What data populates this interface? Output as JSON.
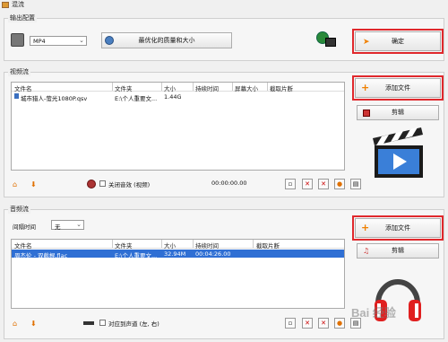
{
  "window": {
    "title": "混流"
  },
  "output": {
    "group_label": "输出配置",
    "format_value": "MP4",
    "quality_button": "最优化的质量和大小",
    "confirm_button": "确定"
  },
  "video": {
    "group_label": "视频流",
    "add_file_button": "添加文件",
    "edit_button": "剪辑",
    "columns": [
      "文件名",
      "文件夹",
      "大小",
      "持续时间",
      "屏幕大小",
      "截取片断"
    ],
    "rows": [
      {
        "name": "城市猎人-萤光1080P.qsv",
        "folder": "E:\\个人重要文...",
        "size": "1.44G",
        "duration": "",
        "screen": "",
        "clip": ""
      }
    ],
    "mute_label": "关闭音效 (视频)",
    "time": "00:00:00.00"
  },
  "audio": {
    "group_label": "音频流",
    "interval_label": "间隔时间",
    "interval_value": "无",
    "add_file_button": "添加文件",
    "edit_button": "剪辑",
    "columns": [
      "文件名",
      "文件夹",
      "大小",
      "持续时间",
      "截取片断"
    ],
    "rows": [
      {
        "name": "周杰伦 - 双截棍.flac",
        "folder": "E:\\个人重要文...",
        "size": "32.94M",
        "duration": "00:04:26.00",
        "clip": ""
      }
    ],
    "align_label": "对应到声道 (左, 右)"
  },
  "watermark": {
    "text": "Bai 经验"
  },
  "colors": {
    "highlight": "#e0282c",
    "selected_row": "#2f6fd4",
    "accent": "#f08000"
  }
}
